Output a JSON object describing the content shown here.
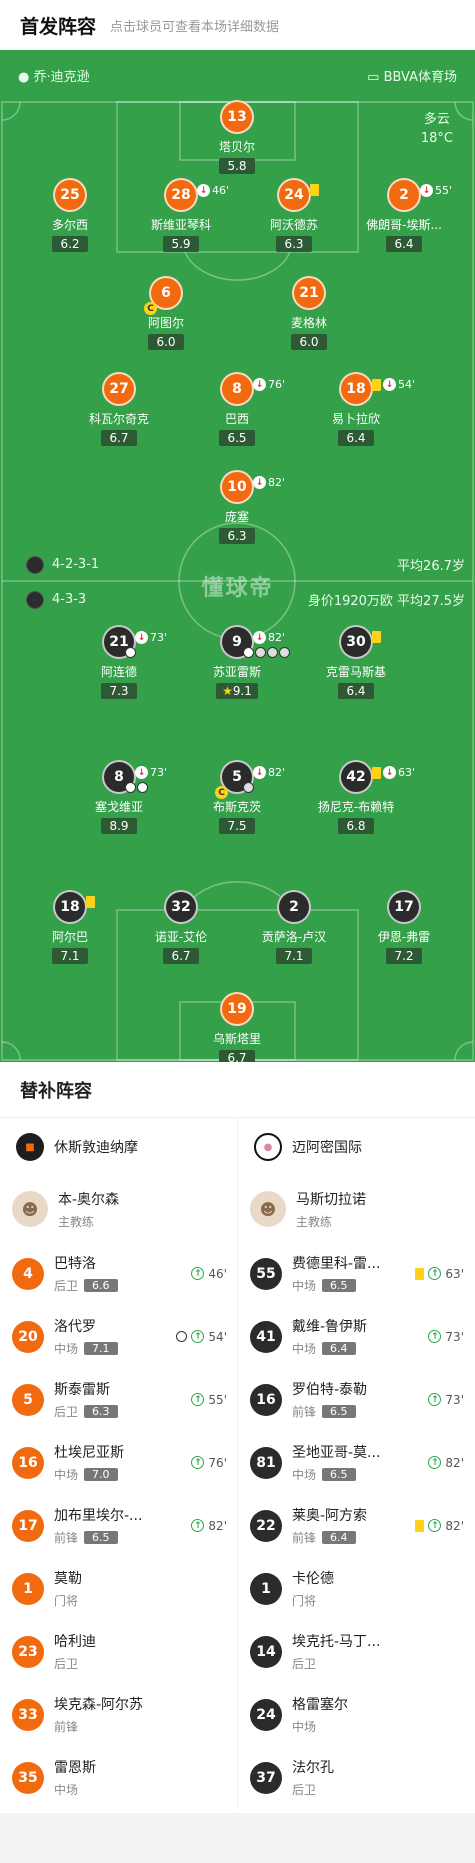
{
  "header": {
    "title": "首发阵容",
    "subtitle": "点击球员可查看本场详细数据"
  },
  "pitch": {
    "coach_home": "乔·迪克逊",
    "venue": "BBVA体育场",
    "weather": "多云",
    "temperature": "18°C",
    "home_formation": "4-2-3-1",
    "home_avg_age": "平均26.7岁",
    "away_formation": "4-3-3",
    "away_value": "身价1920万欧",
    "away_avg_age": "平均27.5岁",
    "watermark": "懂球帝"
  },
  "home_players": [
    {
      "num": "13",
      "name": "塔贝尔",
      "rating": "5.8"
    },
    {
      "num": "25",
      "name": "多尔西",
      "rating": "6.2"
    },
    {
      "num": "28",
      "name": "斯维亚琴科",
      "rating": "5.9",
      "sub": "46'"
    },
    {
      "num": "24",
      "name": "阿沃德苏",
      "rating": "6.3"
    },
    {
      "num": "2",
      "name": "佛朗哥-埃斯...",
      "rating": "6.4",
      "sub": "55'"
    },
    {
      "num": "6",
      "name": "阿图尔",
      "rating": "6.0"
    },
    {
      "num": "21",
      "name": "麦格林",
      "rating": "6.0"
    },
    {
      "num": "27",
      "name": "科瓦尔奇克",
      "rating": "6.7"
    },
    {
      "num": "8",
      "name": "巴西",
      "rating": "6.5",
      "sub": "76'"
    },
    {
      "num": "18",
      "name": "易卜拉欣",
      "rating": "6.4",
      "sub": "54'"
    },
    {
      "num": "10",
      "name": "庞塞",
      "rating": "6.3",
      "sub": "82'"
    }
  ],
  "away_players": [
    {
      "num": "21",
      "name": "阿连德",
      "rating": "7.3",
      "sub": "73'"
    },
    {
      "num": "9",
      "name": "苏亚雷斯",
      "rating": "9.1",
      "sub": "82'"
    },
    {
      "num": "30",
      "name": "克雷马斯基",
      "rating": "6.4"
    },
    {
      "num": "8",
      "name": "塞戈维亚",
      "rating": "8.9",
      "sub": "73'"
    },
    {
      "num": "5",
      "name": "布斯克茨",
      "rating": "7.5",
      "sub": "82'"
    },
    {
      "num": "42",
      "name": "扬尼克-布赖特",
      "rating": "6.8",
      "sub": "63'"
    },
    {
      "num": "18",
      "name": "阿尔巴",
      "rating": "7.1"
    },
    {
      "num": "32",
      "name": "诺亚-艾伦",
      "rating": "6.7"
    },
    {
      "num": "2",
      "name": "贡萨洛-卢汉",
      "rating": "7.1"
    },
    {
      "num": "17",
      "name": "伊恩-弗雷",
      "rating": "7.2"
    },
    {
      "num": "19",
      "name": "乌斯塔里",
      "rating": "6.7"
    }
  ],
  "subs": {
    "title": "替补阵容",
    "home": {
      "team": "休斯敦迪纳摩",
      "coach": {
        "name": "本-奥尔森",
        "role": "主教练"
      },
      "players": [
        {
          "num": "4",
          "name": "巴特洛",
          "pos": "后卫",
          "rating": "6.6",
          "minute": "46'"
        },
        {
          "num": "20",
          "name": "洛代罗",
          "pos": "中场",
          "rating": "7.1",
          "minute": "54'"
        },
        {
          "num": "5",
          "name": "斯泰雷斯",
          "pos": "后卫",
          "rating": "6.3",
          "minute": "55'"
        },
        {
          "num": "16",
          "name": "杜埃尼亚斯",
          "pos": "中场",
          "rating": "7.0",
          "minute": "76'"
        },
        {
          "num": "17",
          "name": "加布里埃尔-...",
          "pos": "前锋",
          "rating": "6.5",
          "minute": "82'"
        },
        {
          "num": "1",
          "name": "莫勒",
          "pos": "门将"
        },
        {
          "num": "23",
          "name": "哈利迪",
          "pos": "后卫"
        },
        {
          "num": "33",
          "name": "埃克森-阿尔苏",
          "pos": "前锋"
        },
        {
          "num": "35",
          "name": "雷恩斯",
          "pos": "中场"
        }
      ]
    },
    "away": {
      "team": "迈阿密国际",
      "coach": {
        "name": "马斯切拉诺",
        "role": "主教练"
      },
      "players": [
        {
          "num": "55",
          "name": "费德里科-雷...",
          "pos": "中场",
          "rating": "6.5",
          "minute": "63'"
        },
        {
          "num": "41",
          "name": "戴维-鲁伊斯",
          "pos": "中场",
          "rating": "6.4",
          "minute": "73'"
        },
        {
          "num": "16",
          "name": "罗伯特-泰勒",
          "pos": "前锋",
          "rating": "6.5",
          "minute": "73'"
        },
        {
          "num": "81",
          "name": "圣地亚哥-莫...",
          "pos": "中场",
          "rating": "6.5",
          "minute": "82'"
        },
        {
          "num": "22",
          "name": "莱奥-阿方索",
          "pos": "前锋",
          "rating": "6.4",
          "minute": "82'"
        },
        {
          "num": "1",
          "name": "卡伦德",
          "pos": "门将"
        },
        {
          "num": "14",
          "name": "埃克托-马丁...",
          "pos": "后卫"
        },
        {
          "num": "24",
          "name": "格雷塞尔",
          "pos": "中场"
        },
        {
          "num": "37",
          "name": "法尔孔",
          "pos": "后卫"
        }
      ]
    }
  },
  "colors": {
    "pitch": "#35a04a",
    "home": "#f26a10",
    "away": "#2b2b2b",
    "rating_bg": "#2d5a35"
  }
}
